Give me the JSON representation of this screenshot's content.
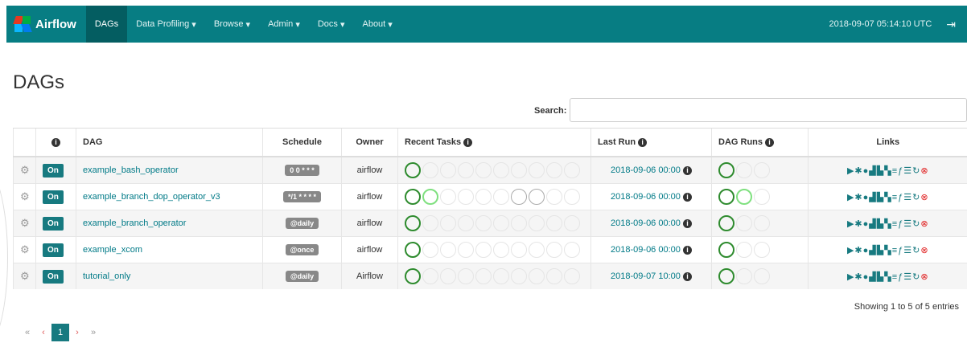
{
  "navbar": {
    "brand": "Airflow",
    "items": [
      "DAGs",
      "Data Profiling",
      "Browse",
      "Admin",
      "Docs",
      "About"
    ],
    "time": "2018-09-07 05:14:10 UTC"
  },
  "page_title": "DAGs",
  "search": {
    "label": "Search:",
    "value": ""
  },
  "table": {
    "headers": [
      "",
      "",
      "DAG",
      "Schedule",
      "Owner",
      "Recent Tasks",
      "Last Run",
      "DAG Runs",
      "Links"
    ],
    "rows": [
      {
        "toggle": "On",
        "dag": "example_bash_operator",
        "schedule": "0 0 * * *",
        "owner": "airflow",
        "last_run": "2018-09-06 00:00"
      },
      {
        "toggle": "On",
        "dag": "example_branch_dop_operator_v3",
        "schedule": "*/1 * * * *",
        "owner": "airflow",
        "last_run": "2018-09-06 00:00"
      },
      {
        "toggle": "On",
        "dag": "example_branch_operator",
        "schedule": "@daily",
        "owner": "airflow",
        "last_run": "2018-09-06 00:00"
      },
      {
        "toggle": "On",
        "dag": "example_xcom",
        "schedule": "@once",
        "owner": "airflow",
        "last_run": "2018-09-06 00:00"
      },
      {
        "toggle": "On",
        "dag": "tutorial_only",
        "schedule": "@daily",
        "owner": "Airflow",
        "last_run": "2018-09-07 10:00"
      }
    ]
  },
  "footer": {
    "showing": "Showing 1 to 5 of 5 entries"
  },
  "pager": {
    "current": "1"
  }
}
